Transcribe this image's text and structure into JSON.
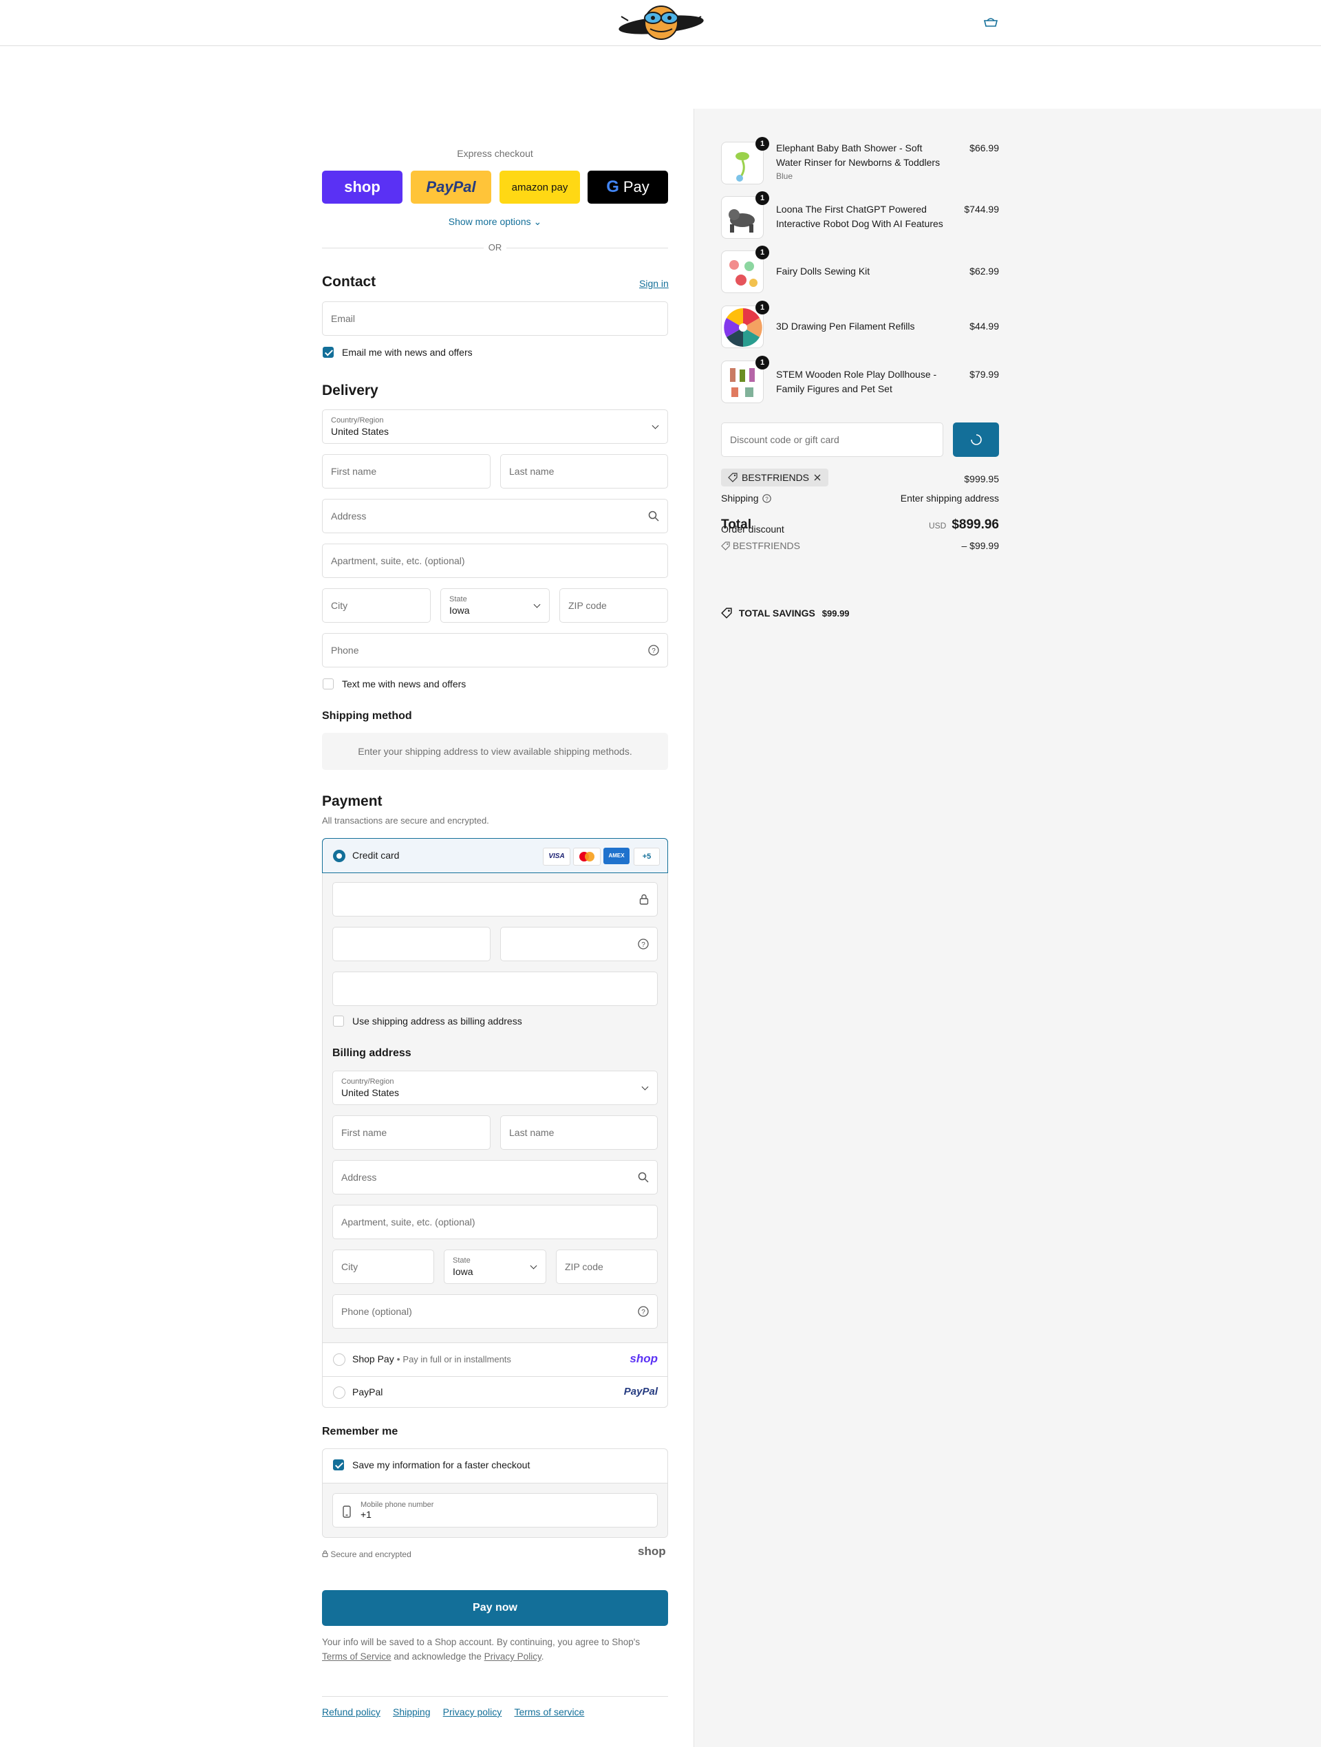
{
  "express": {
    "title": "Express checkout",
    "shop_label": "shop",
    "paypal_label": "PayPal",
    "amazon_label": "amazon pay",
    "gpay_label": "Pay",
    "more_options": "Show more options",
    "or": "OR"
  },
  "contact": {
    "title": "Contact",
    "signin": "Sign in",
    "email_placeholder": "Email",
    "news_label": "Email me with news and offers"
  },
  "delivery": {
    "title": "Delivery",
    "country_label": "Country/Region",
    "country_value": "United States",
    "first_name": "First name",
    "last_name": "Last name",
    "address": "Address",
    "apartment": "Apartment, suite, etc. (optional)",
    "city": "City",
    "state_label": "State",
    "state_value": "Iowa",
    "zip": "ZIP code",
    "phone": "Phone",
    "text_news": "Text me with news and offers"
  },
  "shipping_method": {
    "title": "Shipping method",
    "message": "Enter your shipping address to view available shipping methods."
  },
  "payment": {
    "title": "Payment",
    "subtitle": "All transactions are secure and encrypted.",
    "credit_card": "Credit card",
    "more_cards": "+5",
    "use_shipping": "Use shipping address as billing address",
    "billing_title": "Billing address",
    "country_label": "Country/Region",
    "country_value": "United States",
    "first_name": "First name",
    "last_name": "Last name",
    "address": "Address",
    "apartment": "Apartment, suite, etc. (optional)",
    "city": "City",
    "state_label": "State",
    "state_value": "Iowa",
    "zip": "ZIP code",
    "phone": "Phone (optional)",
    "shoppay": "Shop Pay",
    "shoppay_sub": "Pay in full or in installments",
    "shoppay_logo": "shop",
    "paypal": "PayPal",
    "paypal_logo": "PayPal"
  },
  "remember": {
    "title": "Remember me",
    "save_label": "Save my information for a faster checkout",
    "mobile_label": "Mobile phone number",
    "mobile_value": "+1",
    "secure": "Secure and encrypted",
    "shop_logo": "shop"
  },
  "pay_now": "Pay now",
  "legal": {
    "line1": "Your info will be saved to a Shop account. By continuing, you agree to Shop's",
    "tos": "Terms of Service",
    "mid": "and acknowledge the",
    "privacy": "Privacy Policy",
    "end": "."
  },
  "footer": [
    "Refund policy",
    "Shipping",
    "Privacy policy",
    "Terms of service"
  ],
  "summary": {
    "products": [
      {
        "name": "Elephant Baby Bath Shower - Soft Water Rinser for Newborns & Toddlers",
        "variant": "Blue",
        "price": "$66.99",
        "qty": "1"
      },
      {
        "name": "Loona The First ChatGPT Powered Interactive Robot Dog With AI Features",
        "variant": "",
        "price": "$744.99",
        "qty": "1"
      },
      {
        "name": "Fairy Dolls Sewing Kit",
        "variant": "",
        "price": "$62.99",
        "qty": "1"
      },
      {
        "name": "3D Drawing Pen Filament Refills",
        "variant": "",
        "price": "$44.99",
        "qty": "1"
      },
      {
        "name": "STEM Wooden Role Play Dollhouse - Family Figures and Pet Set",
        "variant": "",
        "price": "$79.99",
        "qty": "1"
      }
    ],
    "discount_placeholder": "Discount code or gift card",
    "applied_code": "BESTFRIENDS",
    "subtotal_value": "$999.95",
    "shipping_label": "Shipping",
    "shipping_value": "Enter shipping address",
    "total_label": "Total",
    "overlap_label": "Order discount",
    "currency": "USD",
    "total_value": "$899.96",
    "discount_code": "BESTFRIENDS",
    "discount_value": "– $99.99",
    "savings_label": "TOTAL SAVINGS",
    "savings_value": "$99.99"
  },
  "colors": {
    "accent": "#136f99",
    "shop_purple": "#5a31f4",
    "paypal_yellow": "#ffc439",
    "amazon_yellow": "#ffd814"
  }
}
